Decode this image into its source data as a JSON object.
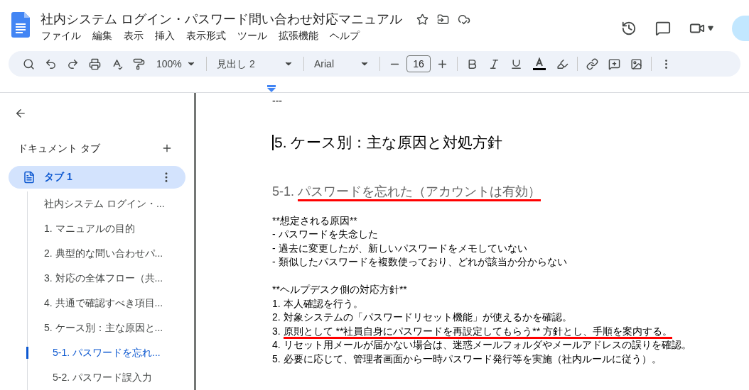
{
  "document": {
    "title": "社内システム ログイン・パスワード問い合わせ対応マニュアル"
  },
  "menu": [
    "ファイル",
    "編集",
    "表示",
    "挿入",
    "表示形式",
    "ツール",
    "拡張機能",
    "ヘルプ"
  ],
  "toolbar": {
    "zoom": "100%",
    "style": "見出し 2",
    "font": "Arial",
    "font_size": "16"
  },
  "sidebar": {
    "heading": "ドキュメント タブ",
    "tabs": [
      {
        "label": "タブ 1",
        "selected": true
      }
    ],
    "outline": [
      {
        "text": "社内システム ログイン・...",
        "selected": false
      },
      {
        "text": "1. マニュアルの目的",
        "selected": false
      },
      {
        "text": "2. 典型的な問い合わせパ...",
        "selected": false
      },
      {
        "text": "3. 対応の全体フロー（共...",
        "selected": false
      },
      {
        "text": "4. 共通で確認すべき項目...",
        "selected": false
      },
      {
        "text": "5. ケース別：主な原因と...",
        "selected": false,
        "children": [
          {
            "text": "5-1. パスワードを忘れ...",
            "selected": true
          },
          {
            "text": "5-2. パスワード誤入力",
            "selected": false
          }
        ]
      }
    ]
  },
  "body": [
    {
      "kind": "rule",
      "text": "---"
    },
    {
      "kind": "h1",
      "text": "5. ケース別：主な原因と対処方針"
    },
    {
      "kind": "h2",
      "prefix": "5-1. ",
      "text": "パスワードを忘れた（アカウントは有効）",
      "underlined": true
    },
    {
      "kind": "text",
      "text": "**想定される原因**",
      "underlined": false
    },
    {
      "kind": "text",
      "text": "- パスワードを失念した",
      "underlined": false
    },
    {
      "kind": "text",
      "text": "- 過去に変更したが、新しいパスワードをメモしていない",
      "underlined": false
    },
    {
      "kind": "text",
      "text": "- 類似したパスワードを複数使っており、どれが該当か分からない",
      "underlined": false
    },
    {
      "kind": "blank"
    },
    {
      "kind": "text",
      "text": "**ヘルプデスク側の対応方針**",
      "underlined": false
    },
    {
      "kind": "text",
      "text": "1. 本人確認を行う。",
      "underlined": false
    },
    {
      "kind": "text",
      "text": "2. 対象システムの「パスワードリセット機能」が使えるかを確認。",
      "underlined": false
    },
    {
      "kind": "text",
      "prefix": "3. ",
      "text": "原則として **社員自身にパスワードを再設定してもらう** 方針とし、手順を案内する。",
      "underlined": true
    },
    {
      "kind": "text",
      "text": "4. リセット用メールが届かない場合は、迷惑メールフォルダやメールアドレスの誤りを確認。",
      "underlined": false
    },
    {
      "kind": "text",
      "text": "5. 必要に応じて、管理者画面から一時パスワード発行等を実施（社内ルールに従う）。",
      "underlined": false
    }
  ]
}
